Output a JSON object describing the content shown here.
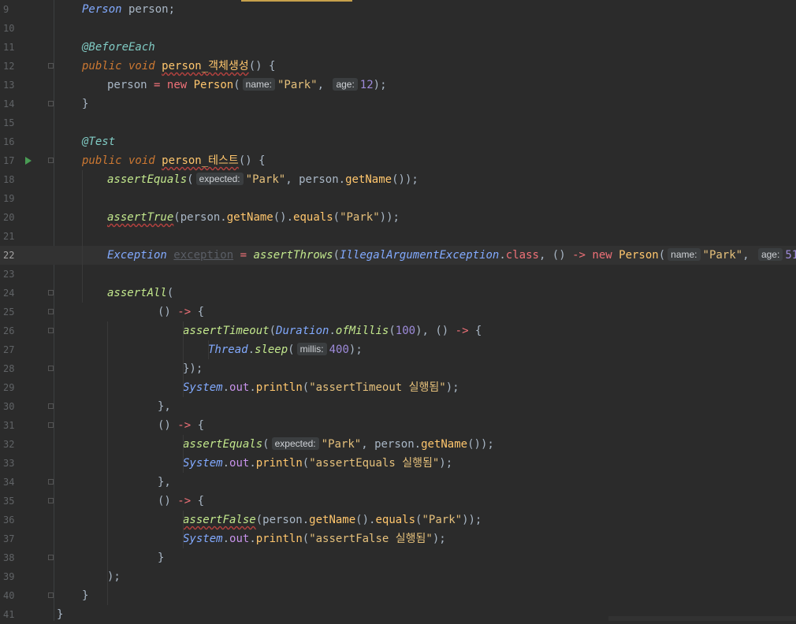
{
  "editor": {
    "current_line": "22",
    "lines": [
      {
        "n": "9",
        "tokens": [
          {
            "t": "Person",
            "c": "ty2"
          },
          {
            "t": " person;"
          }
        ]
      },
      {
        "n": "10",
        "tokens": []
      },
      {
        "n": "11",
        "tokens": [
          {
            "t": "@BeforeEach",
            "c": "an"
          }
        ]
      },
      {
        "n": "12",
        "tokens": [
          {
            "t": "public void ",
            "c": "kwi"
          },
          {
            "t": "person_객체생성",
            "c": "fn sq"
          },
          {
            "t": "() {"
          }
        ]
      },
      {
        "n": "13",
        "indent": 1,
        "tokens": [
          {
            "t": "person "
          },
          {
            "t": "=",
            "c": "pk"
          },
          {
            "t": " "
          },
          {
            "t": "new",
            "c": "pk"
          },
          {
            "t": " "
          },
          {
            "t": "Person",
            "c": "fn"
          },
          {
            "t": "("
          },
          {
            "hint": "name:"
          },
          {
            "t": "\"Park\"",
            "c": "str"
          },
          {
            "t": ", "
          },
          {
            "hint": "age:"
          },
          {
            "t": "12",
            "c": "num"
          },
          {
            "t": ");"
          }
        ]
      },
      {
        "n": "14",
        "tokens": [
          {
            "t": "}"
          }
        ]
      },
      {
        "n": "15",
        "tokens": []
      },
      {
        "n": "16",
        "tokens": [
          {
            "t": "@Test",
            "c": "an"
          }
        ]
      },
      {
        "n": "17",
        "run": true,
        "tokens": [
          {
            "t": "public void ",
            "c": "kwi"
          },
          {
            "t": "person_테스트",
            "c": "fn sq"
          },
          {
            "t": "() {"
          }
        ]
      },
      {
        "n": "18",
        "indent": 1,
        "tokens": [
          {
            "t": "assertEquals",
            "c": "sm"
          },
          {
            "t": "("
          },
          {
            "hint": "expected:"
          },
          {
            "t": "\"Park\"",
            "c": "str"
          },
          {
            "t": ", person."
          },
          {
            "t": "getName",
            "c": "fn"
          },
          {
            "t": "());"
          }
        ]
      },
      {
        "n": "19",
        "tokens": []
      },
      {
        "n": "20",
        "indent": 1,
        "tokens": [
          {
            "t": "assertTrue",
            "c": "sm sq"
          },
          {
            "t": "(person."
          },
          {
            "t": "getName",
            "c": "fn"
          },
          {
            "t": "()."
          },
          {
            "t": "equals",
            "c": "fn"
          },
          {
            "t": "("
          },
          {
            "t": "\"Park\"",
            "c": "str"
          },
          {
            "t": "));"
          }
        ]
      },
      {
        "n": "21",
        "tokens": []
      },
      {
        "n": "22",
        "indent": 1,
        "tokens": [
          {
            "t": "Exception",
            "c": "ty2"
          },
          {
            "t": " "
          },
          {
            "t": "exception",
            "c": "dim"
          },
          {
            "t": " "
          },
          {
            "t": "=",
            "c": "pk"
          },
          {
            "t": " "
          },
          {
            "t": "assertThrows",
            "c": "sm"
          },
          {
            "t": "("
          },
          {
            "t": "IllegalArgumentException",
            "c": "ty2"
          },
          {
            "t": "."
          },
          {
            "t": "class",
            "c": "pk"
          },
          {
            "t": ", () "
          },
          {
            "t": "->",
            "c": "pk"
          },
          {
            "t": " "
          },
          {
            "t": "new",
            "c": "pk"
          },
          {
            "t": " "
          },
          {
            "t": "Person",
            "c": "fn"
          },
          {
            "t": "("
          },
          {
            "hint": "name:"
          },
          {
            "t": "\"Park\"",
            "c": "str"
          },
          {
            "t": ", "
          },
          {
            "hint": "age:"
          },
          {
            "t": "51",
            "c": "num"
          },
          {
            "t": "));"
          }
        ]
      },
      {
        "n": "23",
        "tokens": []
      },
      {
        "n": "24",
        "indent": 1,
        "tokens": [
          {
            "t": "assertAll",
            "c": "sm"
          },
          {
            "t": "("
          }
        ]
      },
      {
        "n": "25",
        "indent": 3,
        "tokens": [
          {
            "t": "() "
          },
          {
            "t": "->",
            "c": "pk"
          },
          {
            "t": " {"
          }
        ]
      },
      {
        "n": "26",
        "indent": 4,
        "tokens": [
          {
            "t": "assertTimeout",
            "c": "sm"
          },
          {
            "t": "("
          },
          {
            "t": "Duration",
            "c": "ty2"
          },
          {
            "t": "."
          },
          {
            "t": "ofMillis",
            "c": "sm"
          },
          {
            "t": "("
          },
          {
            "t": "100",
            "c": "num"
          },
          {
            "t": "), () "
          },
          {
            "t": "->",
            "c": "pk"
          },
          {
            "t": " {"
          }
        ]
      },
      {
        "n": "27",
        "indent": 5,
        "tokens": [
          {
            "t": "Thread",
            "c": "ty2"
          },
          {
            "t": "."
          },
          {
            "t": "sleep",
            "c": "sm"
          },
          {
            "t": "("
          },
          {
            "hint": "millis:"
          },
          {
            "t": "400",
            "c": "num"
          },
          {
            "t": ");"
          }
        ]
      },
      {
        "n": "28",
        "indent": 4,
        "tokens": [
          {
            "t": "});"
          }
        ]
      },
      {
        "n": "29",
        "indent": 4,
        "tokens": [
          {
            "t": "System",
            "c": "ty2"
          },
          {
            "t": "."
          },
          {
            "t": "out",
            "c": "fld"
          },
          {
            "t": "."
          },
          {
            "t": "println",
            "c": "fn"
          },
          {
            "t": "("
          },
          {
            "t": "\"assertTimeout 실행됨\"",
            "c": "str"
          },
          {
            "t": ");"
          }
        ]
      },
      {
        "n": "30",
        "indent": 3,
        "tokens": [
          {
            "t": "},"
          }
        ]
      },
      {
        "n": "31",
        "indent": 3,
        "tokens": [
          {
            "t": "() "
          },
          {
            "t": "->",
            "c": "pk"
          },
          {
            "t": " {"
          }
        ]
      },
      {
        "n": "32",
        "indent": 4,
        "tokens": [
          {
            "t": "assertEquals",
            "c": "sm"
          },
          {
            "t": "("
          },
          {
            "hint": "expected:"
          },
          {
            "t": "\"Park\"",
            "c": "str"
          },
          {
            "t": ", person."
          },
          {
            "t": "getName",
            "c": "fn"
          },
          {
            "t": "());"
          }
        ]
      },
      {
        "n": "33",
        "indent": 4,
        "tokens": [
          {
            "t": "System",
            "c": "ty2"
          },
          {
            "t": "."
          },
          {
            "t": "out",
            "c": "fld"
          },
          {
            "t": "."
          },
          {
            "t": "println",
            "c": "fn"
          },
          {
            "t": "("
          },
          {
            "t": "\"assertEquals 실행됨\"",
            "c": "str"
          },
          {
            "t": ");"
          }
        ]
      },
      {
        "n": "34",
        "indent": 3,
        "tokens": [
          {
            "t": "},"
          }
        ]
      },
      {
        "n": "35",
        "indent": 3,
        "tokens": [
          {
            "t": "() "
          },
          {
            "t": "->",
            "c": "pk"
          },
          {
            "t": " {"
          }
        ]
      },
      {
        "n": "36",
        "indent": 4,
        "tokens": [
          {
            "t": "assertFalse",
            "c": "sm sq"
          },
          {
            "t": "(person."
          },
          {
            "t": "getName",
            "c": "fn"
          },
          {
            "t": "()."
          },
          {
            "t": "equals",
            "c": "fn"
          },
          {
            "t": "("
          },
          {
            "t": "\"Park\"",
            "c": "str"
          },
          {
            "t": "));"
          }
        ]
      },
      {
        "n": "37",
        "indent": 4,
        "tokens": [
          {
            "t": "System",
            "c": "ty2"
          },
          {
            "t": "."
          },
          {
            "t": "out",
            "c": "fld"
          },
          {
            "t": "."
          },
          {
            "t": "println",
            "c": "fn"
          },
          {
            "t": "("
          },
          {
            "t": "\"assertFalse 실행됨\"",
            "c": "str"
          },
          {
            "t": ");"
          }
        ]
      },
      {
        "n": "38",
        "indent": 3,
        "tokens": [
          {
            "t": "}"
          }
        ]
      },
      {
        "n": "39",
        "indent": 1,
        "tokens": [
          {
            "t": ");"
          }
        ]
      },
      {
        "n": "40",
        "tokens": [
          {
            "t": "}"
          }
        ]
      },
      {
        "n": "41",
        "indent": -1,
        "tokens": [
          {
            "t": "}"
          }
        ]
      }
    ],
    "fold_lines": [
      "12",
      "14",
      "17",
      "24",
      "25",
      "26",
      "28",
      "30",
      "31",
      "34",
      "35",
      "38",
      "40"
    ],
    "colors": {
      "background": "#2b2b2b",
      "current_line": "#323232",
      "keyword": "#cc7832",
      "string": "#e5c07b",
      "number": "#9e8bdb",
      "annotation": "#80cbc4",
      "run_icon": "#499c54"
    }
  }
}
